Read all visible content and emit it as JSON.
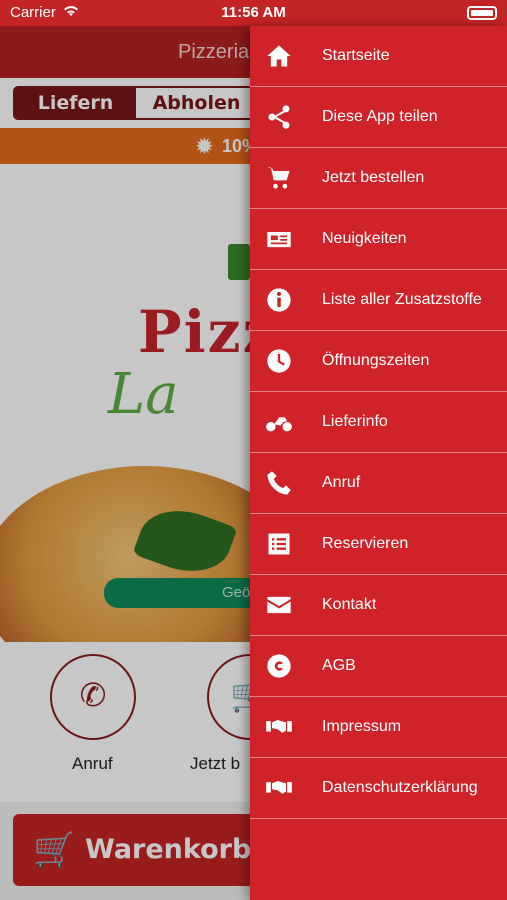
{
  "status_bar": {
    "carrier": "Carrier",
    "time": "11:56 AM"
  },
  "header": {
    "title": "Pizzeria"
  },
  "order_mode": {
    "options": [
      "Liefern",
      "Abholen"
    ],
    "selected": "Liefern"
  },
  "promo": {
    "text": "10%"
  },
  "logo": {
    "name_visible": "Pizz",
    "sub_visible": "La"
  },
  "status_pill": {
    "text": "Geö"
  },
  "quick_actions": [
    {
      "label": "Anruf",
      "icon": "phone-icon"
    },
    {
      "label": "Jetzt b",
      "icon": "cart-icon"
    }
  ],
  "cart": {
    "label": "Warenkorb"
  },
  "drawer": {
    "items": [
      {
        "label": "Startseite",
        "icon": "home-icon"
      },
      {
        "label": "Diese App teilen",
        "icon": "share-icon"
      },
      {
        "label": "Jetzt bestellen",
        "icon": "cart-icon"
      },
      {
        "label": "Neuigkeiten",
        "icon": "newspaper-icon"
      },
      {
        "label": "Liste aller Zusatzstoffe",
        "icon": "info-icon"
      },
      {
        "label": "Öffnungszeiten",
        "icon": "clock-icon"
      },
      {
        "label": "Lieferinfo",
        "icon": "motorcycle-icon"
      },
      {
        "label": "Anruf",
        "icon": "phone-icon"
      },
      {
        "label": "Reservieren",
        "icon": "list-icon"
      },
      {
        "label": "Kontakt",
        "icon": "envelope-icon"
      },
      {
        "label": "AGB",
        "icon": "copyright-icon"
      },
      {
        "label": "Impressum",
        "icon": "handshake-icon"
      },
      {
        "label": "Datenschutzerklärung",
        "icon": "handshake-icon"
      }
    ]
  },
  "colors": {
    "primary": "#cf2329",
    "dark": "#7a1515",
    "promo": "#e36b1a",
    "green": "#0f8a5a"
  }
}
